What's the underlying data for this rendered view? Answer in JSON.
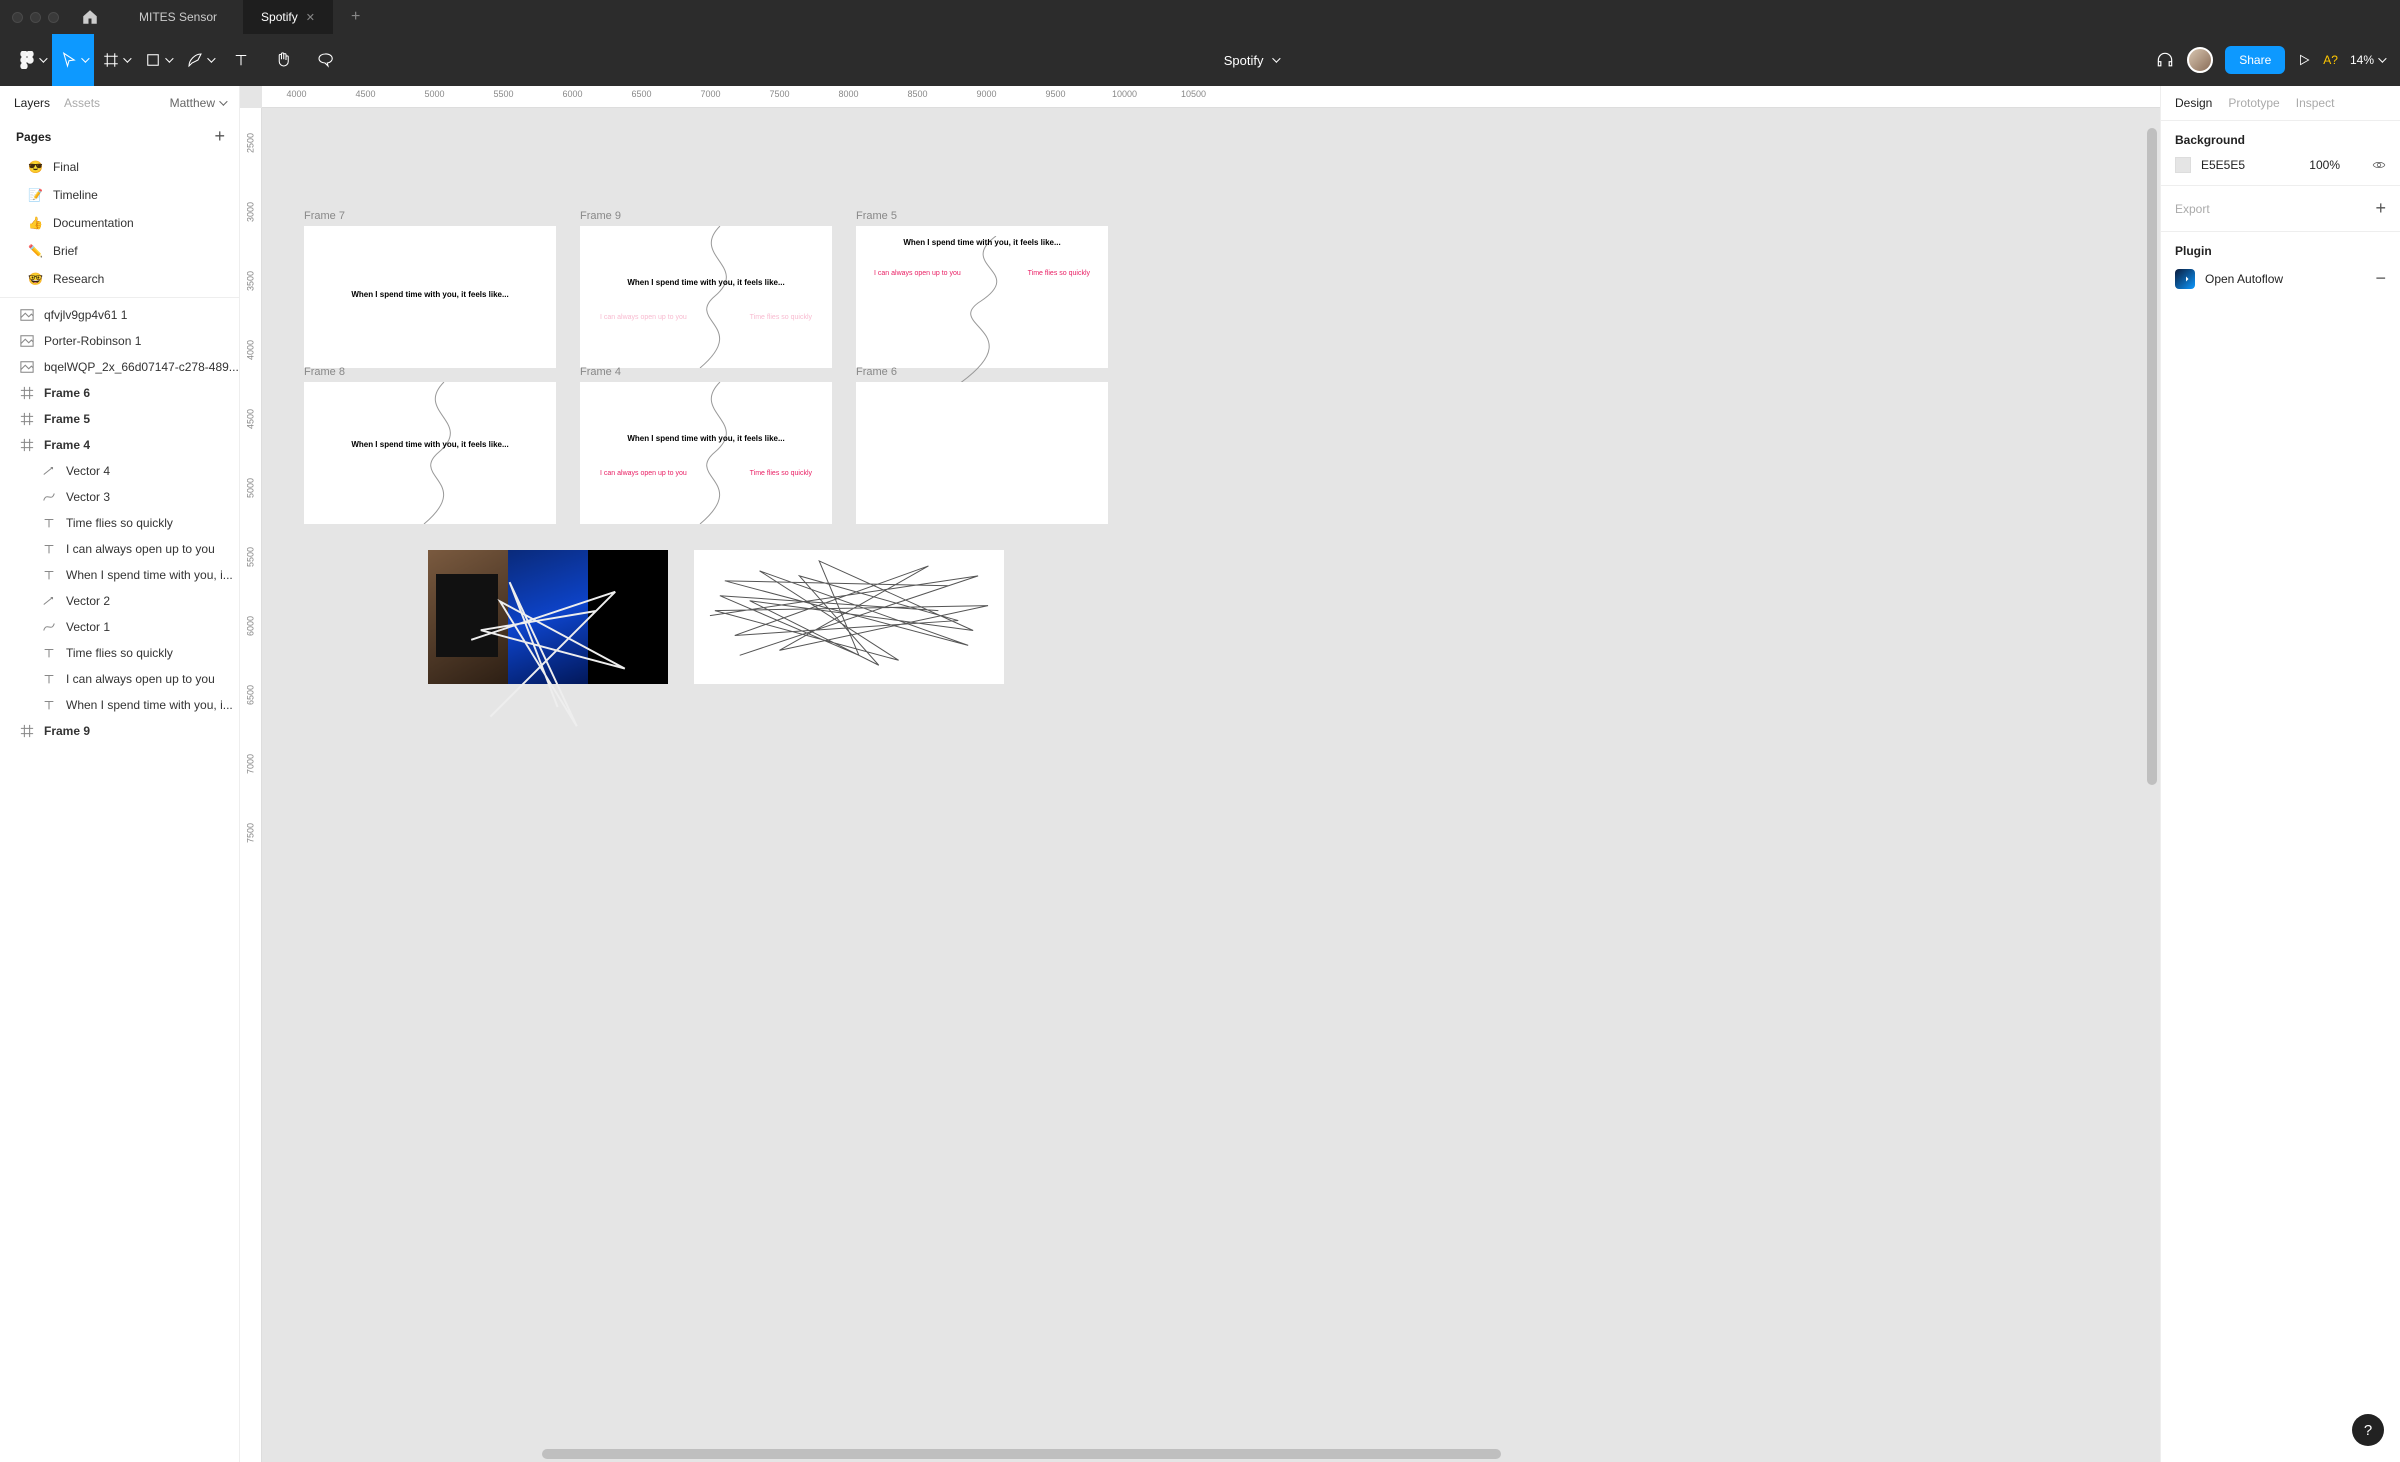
{
  "titlebar": {
    "tab1": "MITES Sensor",
    "tab2": "Spotify"
  },
  "toolbar": {
    "title": "Spotify",
    "share": "Share",
    "missing_fonts": "A?",
    "zoom": "14%"
  },
  "left": {
    "tabs": {
      "layers": "Layers",
      "assets": "Assets"
    },
    "user": "Matthew",
    "pages_label": "Pages",
    "pages": [
      {
        "icon": "😎",
        "label": "Final"
      },
      {
        "icon": "📝",
        "label": "Timeline"
      },
      {
        "icon": "👍",
        "label": "Documentation"
      },
      {
        "icon": "✏️",
        "label": "Brief"
      },
      {
        "icon": "🤓",
        "label": "Research"
      }
    ],
    "layers": [
      {
        "type": "image",
        "label": "qfvjlv9gp4v61 1"
      },
      {
        "type": "image",
        "label": "Porter-Robinson 1"
      },
      {
        "type": "image",
        "label": "bqelWQP_2x_66d07147-c278-489..."
      },
      {
        "type": "frame",
        "label": "Frame 6",
        "bold": true
      },
      {
        "type": "frame",
        "label": "Frame 5",
        "bold": true
      },
      {
        "type": "frame",
        "label": "Frame 4",
        "bold": true
      },
      {
        "type": "vector",
        "label": "Vector 4",
        "indent": 1
      },
      {
        "type": "vector2",
        "label": "Vector 3",
        "indent": 1
      },
      {
        "type": "text",
        "label": "Time flies so quickly",
        "indent": 1
      },
      {
        "type": "text",
        "label": "I can always open up to you",
        "indent": 1
      },
      {
        "type": "text",
        "label": "When I spend time with you, i...",
        "indent": 1
      },
      {
        "type": "vector",
        "label": "Vector 2",
        "indent": 1
      },
      {
        "type": "vector2",
        "label": "Vector 1",
        "indent": 1
      },
      {
        "type": "text",
        "label": "Time flies so quickly",
        "indent": 1
      },
      {
        "type": "text",
        "label": "I can always open up to you",
        "indent": 1
      },
      {
        "type": "text",
        "label": "When I spend time with you, i...",
        "indent": 1
      },
      {
        "type": "frame",
        "label": "Frame 9",
        "bold": true
      }
    ]
  },
  "ruler": {
    "h": [
      "4000",
      "4500",
      "5000",
      "5500",
      "6000",
      "6500",
      "7000",
      "7500",
      "8000",
      "8500",
      "9000",
      "9500",
      "10000",
      "10500"
    ],
    "v": [
      "2500",
      "3000",
      "3500",
      "4000",
      "4500",
      "5000",
      "5500",
      "6000",
      "6500",
      "7000",
      "7500"
    ]
  },
  "canvas": {
    "frames": {
      "f7": "Frame 7",
      "f9": "Frame 9",
      "f5": "Frame 5",
      "f8": "Frame 8",
      "f4": "Frame 4",
      "f6": "Frame 6"
    },
    "text": {
      "spend": "When I spend time with you, it feels like...",
      "open": "I can always open up to you",
      "flies": "Time flies so quickly"
    }
  },
  "right": {
    "tabs": {
      "design": "Design",
      "prototype": "Prototype",
      "inspect": "Inspect"
    },
    "background_label": "Background",
    "bg_hex": "E5E5E5",
    "bg_opacity": "100%",
    "export_label": "Export",
    "plugin_label": "Plugin",
    "plugin_name": "Open Autoflow"
  }
}
